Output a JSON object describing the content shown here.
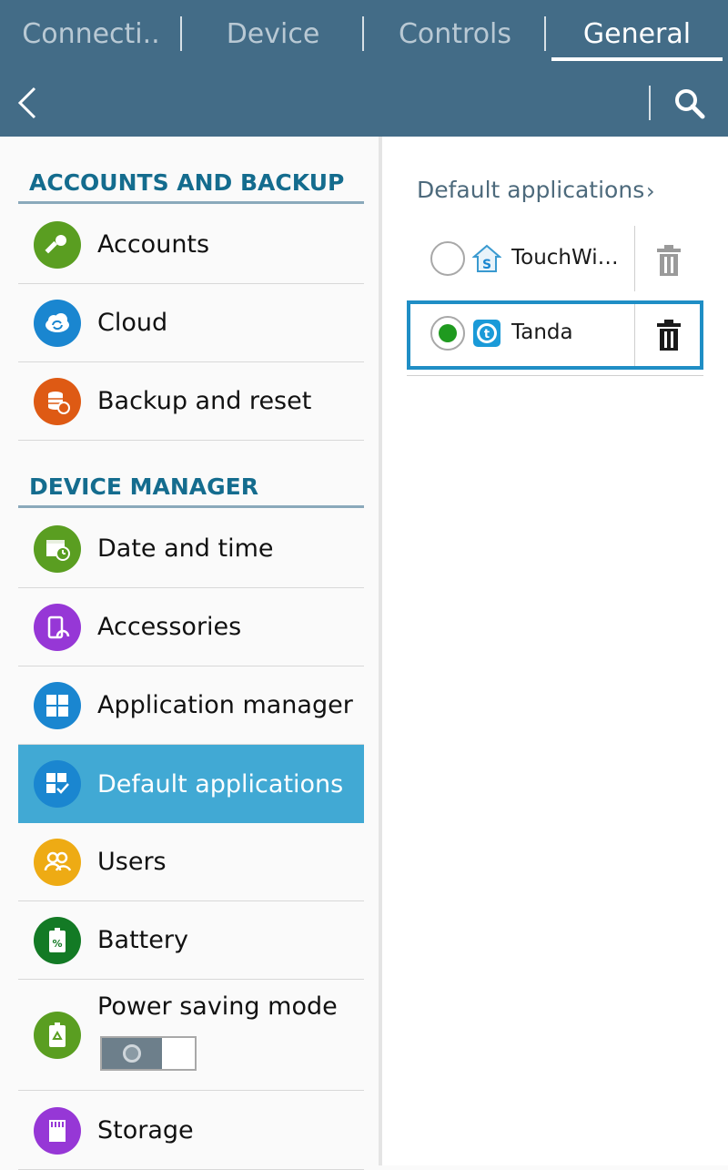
{
  "tabs": [
    {
      "label": "Connecti..",
      "active": false
    },
    {
      "label": "Device",
      "active": false
    },
    {
      "label": "Controls",
      "active": false
    },
    {
      "label": "General",
      "active": true
    }
  ],
  "sections": {
    "accounts_backup": "ACCOUNTS AND BACKUP",
    "device_manager": "DEVICE MANAGER"
  },
  "menu": {
    "accounts": "Accounts",
    "cloud": "Cloud",
    "backup_reset": "Backup and reset",
    "date_time": "Date and time",
    "accessories": "Accessories",
    "app_manager": "Application manager",
    "default_apps": "Default applications",
    "users": "Users",
    "battery": "Battery",
    "power_saving": "Power saving mode",
    "storage": "Storage"
  },
  "detail": {
    "breadcrumb": "Default applications",
    "apps": [
      {
        "name": "TouchWiz...",
        "selected": false
      },
      {
        "name": "Tanda",
        "selected": true
      }
    ]
  },
  "icons": {
    "back": "chevron-left-icon",
    "search": "search-icon"
  },
  "colors": {
    "header": "#436c87",
    "accent": "#146c8e",
    "selected_row": "#41a9d4",
    "selected_app_border": "#1f8ec5",
    "radio_on": "#1f9a1f"
  },
  "power_saving_toggle": "off"
}
